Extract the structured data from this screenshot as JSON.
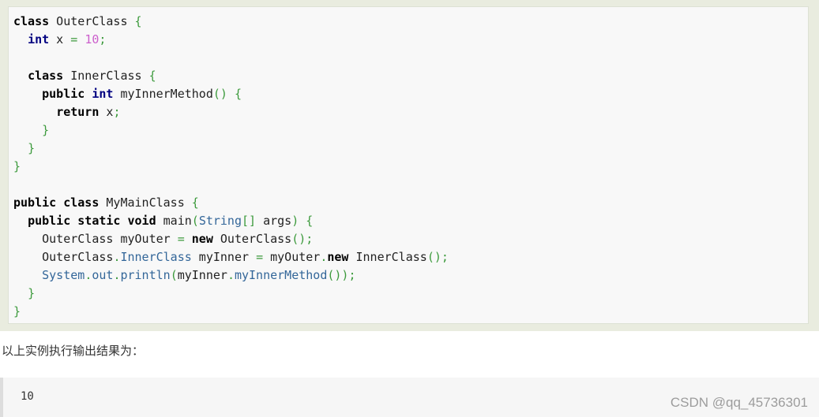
{
  "code_block": {
    "lines": [
      [
        {
          "t": "class",
          "c": "kw"
        },
        {
          "t": " OuterClass ",
          "c": "t"
        },
        {
          "t": "{",
          "c": "p"
        }
      ],
      [
        {
          "t": "  ",
          "c": "t"
        },
        {
          "t": "int",
          "c": "kt"
        },
        {
          "t": " x ",
          "c": "t"
        },
        {
          "t": "=",
          "c": "p"
        },
        {
          "t": " ",
          "c": "t"
        },
        {
          "t": "10",
          "c": "num"
        },
        {
          "t": ";",
          "c": "p"
        }
      ],
      [],
      [
        {
          "t": "  ",
          "c": "t"
        },
        {
          "t": "class",
          "c": "kw"
        },
        {
          "t": " InnerClass ",
          "c": "t"
        },
        {
          "t": "{",
          "c": "p"
        }
      ],
      [
        {
          "t": "    ",
          "c": "t"
        },
        {
          "t": "public",
          "c": "kw"
        },
        {
          "t": " ",
          "c": "t"
        },
        {
          "t": "int",
          "c": "kt"
        },
        {
          "t": " myInnerMethod",
          "c": "t"
        },
        {
          "t": "()",
          "c": "p"
        },
        {
          "t": " ",
          "c": "t"
        },
        {
          "t": "{",
          "c": "p"
        }
      ],
      [
        {
          "t": "      ",
          "c": "t"
        },
        {
          "t": "return",
          "c": "kw"
        },
        {
          "t": " x",
          "c": "t"
        },
        {
          "t": ";",
          "c": "p"
        }
      ],
      [
        {
          "t": "    ",
          "c": "t"
        },
        {
          "t": "}",
          "c": "p"
        }
      ],
      [
        {
          "t": "  ",
          "c": "t"
        },
        {
          "t": "}",
          "c": "p"
        }
      ],
      [
        {
          "t": "}",
          "c": "p"
        }
      ],
      [],
      [
        {
          "t": "public",
          "c": "kw"
        },
        {
          "t": " ",
          "c": "t"
        },
        {
          "t": "class",
          "c": "kw"
        },
        {
          "t": " MyMainClass ",
          "c": "t"
        },
        {
          "t": "{",
          "c": "p"
        }
      ],
      [
        {
          "t": "  ",
          "c": "t"
        },
        {
          "t": "public",
          "c": "kw"
        },
        {
          "t": " ",
          "c": "t"
        },
        {
          "t": "static",
          "c": "kw"
        },
        {
          "t": " ",
          "c": "t"
        },
        {
          "t": "void",
          "c": "kw"
        },
        {
          "t": " main",
          "c": "t"
        },
        {
          "t": "(",
          "c": "p"
        },
        {
          "t": "String",
          "c": "ty"
        },
        {
          "t": "[]",
          "c": "p"
        },
        {
          "t": " args",
          "c": "t"
        },
        {
          "t": ")",
          "c": "p"
        },
        {
          "t": " ",
          "c": "t"
        },
        {
          "t": "{",
          "c": "p"
        }
      ],
      [
        {
          "t": "    OuterClass myOuter ",
          "c": "t"
        },
        {
          "t": "=",
          "c": "p"
        },
        {
          "t": " ",
          "c": "t"
        },
        {
          "t": "new",
          "c": "kw"
        },
        {
          "t": " OuterClass",
          "c": "t"
        },
        {
          "t": "();",
          "c": "p"
        }
      ],
      [
        {
          "t": "    OuterClass",
          "c": "t"
        },
        {
          "t": ".",
          "c": "p"
        },
        {
          "t": "InnerClass",
          "c": "ty"
        },
        {
          "t": " myInner ",
          "c": "t"
        },
        {
          "t": "=",
          "c": "p"
        },
        {
          "t": " myOuter",
          "c": "t"
        },
        {
          "t": ".",
          "c": "p"
        },
        {
          "t": "new",
          "c": "kw"
        },
        {
          "t": " InnerClass",
          "c": "t"
        },
        {
          "t": "();",
          "c": "p"
        }
      ],
      [
        {
          "t": "    ",
          "c": "t"
        },
        {
          "t": "System",
          "c": "ty"
        },
        {
          "t": ".",
          "c": "p"
        },
        {
          "t": "out",
          "c": "ty"
        },
        {
          "t": ".",
          "c": "p"
        },
        {
          "t": "println",
          "c": "ty"
        },
        {
          "t": "(",
          "c": "p"
        },
        {
          "t": "myInner",
          "c": "t"
        },
        {
          "t": ".",
          "c": "p"
        },
        {
          "t": "myInnerMethod",
          "c": "ty"
        },
        {
          "t": "());",
          "c": "p"
        }
      ],
      [
        {
          "t": "  ",
          "c": "t"
        },
        {
          "t": "}",
          "c": "p"
        }
      ],
      [
        {
          "t": "}",
          "c": "p"
        }
      ]
    ]
  },
  "caption": "以上实例执行输出结果为：",
  "output": {
    "text": "10"
  },
  "watermark": "CSDN @qq_45736301",
  "colors": {
    "keyword": "#000000",
    "type_keyword": "#000080",
    "number": "#cc5fcc",
    "punctuation": "#3c9a3c",
    "identifier_blue": "#336699",
    "code_background": "#f8f8f8",
    "outer_background": "#e9ecdf"
  }
}
